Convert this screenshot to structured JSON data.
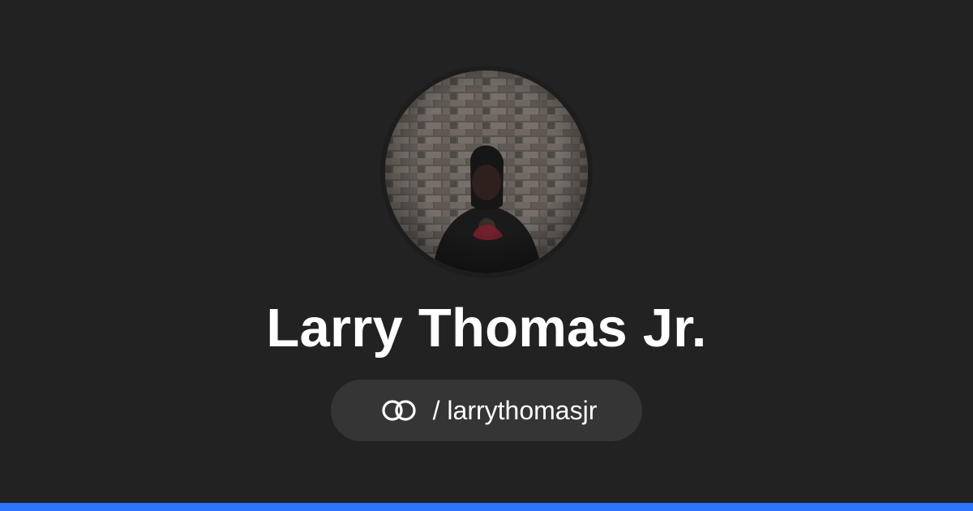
{
  "profile": {
    "name": "Larry Thomas Jr.",
    "handle": "/ larrythomasjr"
  },
  "icons": {
    "logo": "linked-rings-icon"
  },
  "colors": {
    "background": "#222222",
    "pill": "#353535",
    "text": "#ffffff",
    "accent": "#2d73ff"
  }
}
